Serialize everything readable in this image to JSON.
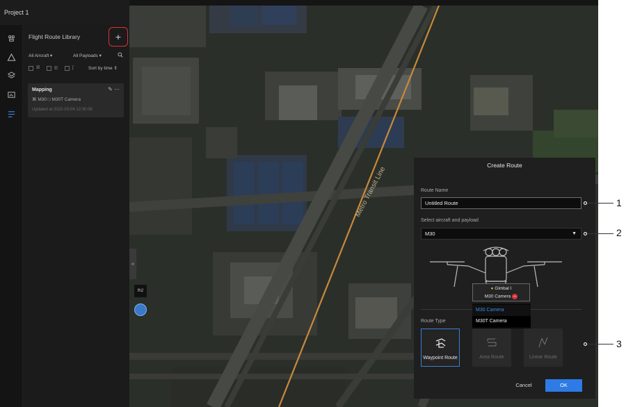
{
  "project": {
    "title": "Project 1"
  },
  "rail": {
    "icons": [
      "drone-icon",
      "warning-triangle-icon",
      "layers-icon",
      "media-icon",
      "route-library-icon"
    ]
  },
  "library": {
    "title": "Flight Route Library",
    "add_label": "+",
    "filters": {
      "aircraft": "All Aircraft ▾",
      "payloads": "All Payloads ▾",
      "sort": "Sort by time ⇕"
    },
    "routes": [
      {
        "name": "Mapping",
        "aircraft": "M30",
        "camera": "M30T Camera",
        "updated": "Updated at 2022-03-04 12:30:08"
      }
    ]
  },
  "map": {
    "road_label": "Metro Transit Line",
    "collapse_label": "«",
    "mini_label": "fh2"
  },
  "dialog": {
    "title": "Create Route",
    "route_name_label": "Route Name",
    "route_name_value": "Untitled Route",
    "aircraft_label": "Select aircraft and payload",
    "aircraft_value": "M30",
    "gimbal_title": "Gimbal I",
    "gimbal_camera": "M30 Camera",
    "camera_options": [
      "M30 Camera",
      "M30T Camera"
    ],
    "route_type_label": "Route Type",
    "route_types": [
      {
        "label": "Waypoint Route",
        "active": true
      },
      {
        "label": "Area Route",
        "active": false
      },
      {
        "label": "Linear Route",
        "active": false
      }
    ],
    "cancel_label": "Cancel",
    "ok_label": "OK"
  },
  "callouts": [
    "1",
    "2",
    "3"
  ],
  "colors": {
    "accent": "#2d7be6",
    "highlight": "#e0303a",
    "selected_option": "#3b8ce6"
  }
}
